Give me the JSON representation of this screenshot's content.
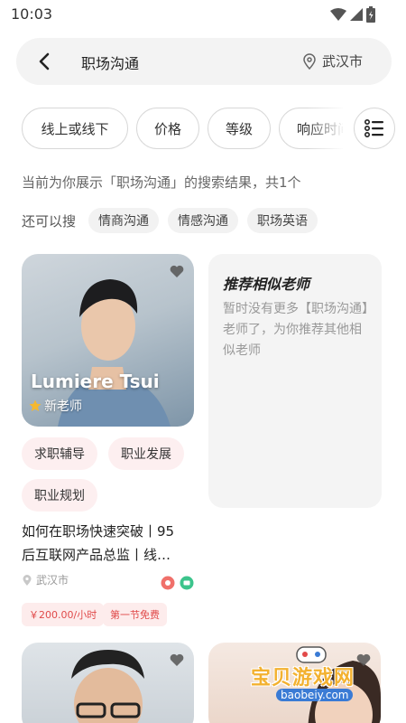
{
  "status_bar": {
    "time": "10:03"
  },
  "search": {
    "query": "职场沟通",
    "location": "武汉市"
  },
  "filters": [
    {
      "label": "线上或线下"
    },
    {
      "label": "价格"
    },
    {
      "label": "等级"
    },
    {
      "label": "响应时间"
    }
  ],
  "result_summary": "当前为你展示「职场沟通」的搜索结果，共1个",
  "suggestions": {
    "label": "还可以搜",
    "tags": [
      "情商沟通",
      "情感沟通",
      "职场英语"
    ]
  },
  "teacher_card": {
    "name": "Lumiere Tsui",
    "badge": "新老师",
    "tags": [
      "求职辅导",
      "职业发展",
      "职业规划"
    ],
    "course_title_line1": "如何在职场快速突破丨95",
    "course_title_line2": "后互联网产品总监丨线…",
    "location": "武汉市",
    "price": "￥200.00/小时",
    "promo": "第一节免费"
  },
  "recommend_panel": {
    "title": "推荐相似老师",
    "text": "暂时没有更多【职场沟通】老师了，为你推荐其他相似老师"
  },
  "watermark": {
    "text": "宝贝游戏网",
    "url": "baobeiy.com"
  },
  "colors": {
    "tag_bg": "#fdeff0",
    "price_red": "#e04a4a",
    "panel_bg": "#f4f4f4",
    "watermark": "#f3b130"
  }
}
